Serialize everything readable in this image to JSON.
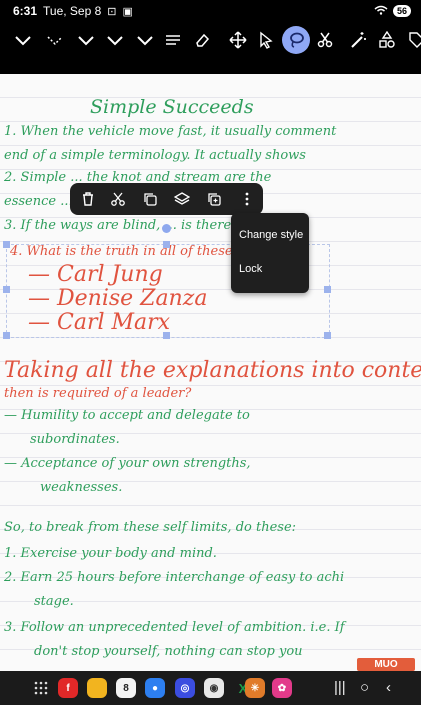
{
  "status_bar": {
    "time": "6:31",
    "date": "Tue, Sep 8",
    "battery": "56"
  },
  "toolbar": {
    "tools": [
      "pen-1-icon",
      "pen-2-icon",
      "pen-3-icon",
      "pen-4-icon",
      "pen-5-icon",
      "text-lines-icon",
      "eraser-icon",
      "move-icon",
      "select-arrow-icon",
      "lasso-icon",
      "scissors-icon",
      "magic-wand-icon",
      "shapes-icon",
      "tag-icon"
    ],
    "active_tool": "lasso-icon"
  },
  "note": {
    "title": "Simple Succeeds",
    "lines": [
      "1. When the vehicle move fast, it usually comment",
      "end of a simple terminology. It actually shows",
      "2. Simple ... the knot and stream are the",
      "essence ... for leaders of",
      "3. If the ways are blind, ... is there fo"
    ],
    "selected_lines": [
      "4. What is the truth in all of these ...?",
      "— Carl Jung",
      "— Denise Zanza",
      "— Carl Marx"
    ],
    "more_lines": [
      "Taking all the explanations into context —",
      "then is required of a leader?",
      "— Humility to accept and delegate to",
      "subordinates.",
      "— Acceptance of your own strengths,",
      "weaknesses.",
      "So, to break from these self limits, do these:",
      "1. Exercise your body and mind.",
      "2. Earn 25 hours before interchange of easy to achi",
      "stage.",
      "3. Follow an unprecedented level of ambition. i.e. If",
      "don't stop yourself, nothing can stop you"
    ]
  },
  "selection_toolbar": {
    "actions": [
      "delete-icon",
      "cut-icon",
      "copy-icon",
      "layers-icon",
      "duplicate-icon",
      "more-vertical-icon"
    ]
  },
  "context_menu": {
    "items": [
      "Change style",
      "Lock"
    ]
  },
  "watermark": "MUO",
  "dock": {
    "apps": [
      "flipboard-icon",
      "notes-icon",
      "calendar-icon",
      "messages-icon",
      "browser-icon",
      "camera-icon",
      "excel-icon",
      "asterisk-app-icon",
      "flower-app-icon"
    ],
    "calendar_day": "8"
  },
  "colors": {
    "green_ink": "#2e9e5c",
    "red_ink": "#e0533f",
    "accent": "#8fa8f5"
  }
}
